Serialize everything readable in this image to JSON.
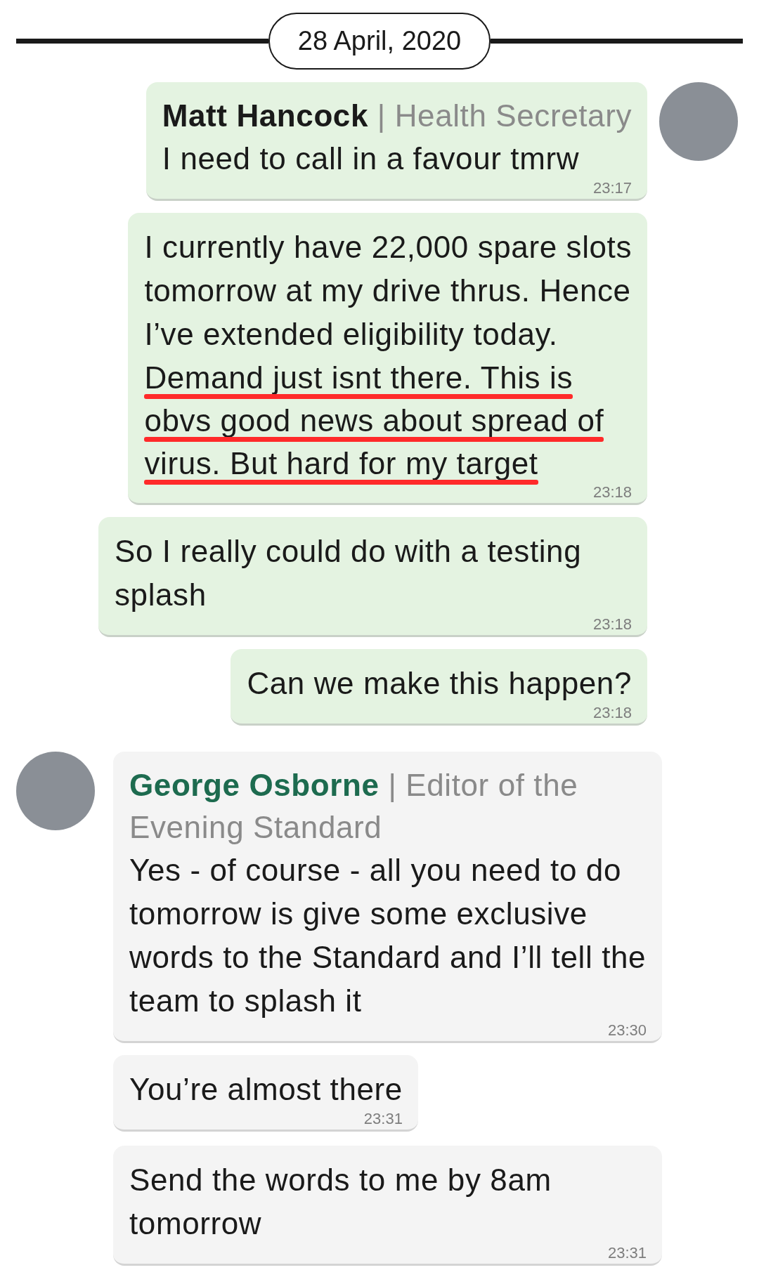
{
  "date": "28 April, 2020",
  "messages": [
    {
      "kind": "outgoing",
      "avatar": true,
      "sender": {
        "name": "Matt Hancock",
        "separator": "|",
        "role": "Health Secretary"
      },
      "text": "I need to call in a favour tmrw",
      "time": "23:17"
    },
    {
      "kind": "outgoing",
      "avatar": false,
      "lines": [
        {
          "text": "I currently have 22,000 spare slots",
          "underlined": false
        },
        {
          "text": "tomorrow at my drive thrus. Hence",
          "underlined": false
        },
        {
          "text": "I’ve extended eligibility today.",
          "underlined": false
        },
        {
          "text": "Demand just isnt there. This is",
          "underlined": true
        },
        {
          "text": "obvs good news about spread of",
          "underlined": true
        },
        {
          "text": "virus. But hard for my target",
          "underlined": true
        }
      ],
      "time": "23:18"
    },
    {
      "kind": "outgoing",
      "avatar": false,
      "text": "So I really could do with a testing splash",
      "time": "23:18"
    },
    {
      "kind": "outgoing",
      "avatar": false,
      "text": "Can we make this happen?",
      "time": "23:18"
    },
    {
      "kind": "incoming",
      "avatar": true,
      "sender": {
        "name": "George Osborne",
        "separator": "|",
        "role": "Editor of the Evening Standard"
      },
      "text": "Yes - of course - all you need to do tomorrow is give some exclusive words to the Standard and I’ll tell the team to splash it",
      "time": "23:30"
    },
    {
      "kind": "incoming",
      "avatar": false,
      "text": "You’re almost there",
      "time": "23:31"
    },
    {
      "kind": "incoming",
      "avatar": false,
      "text": "Send the words to me by 8am tomorrow",
      "time": "23:31"
    }
  ]
}
